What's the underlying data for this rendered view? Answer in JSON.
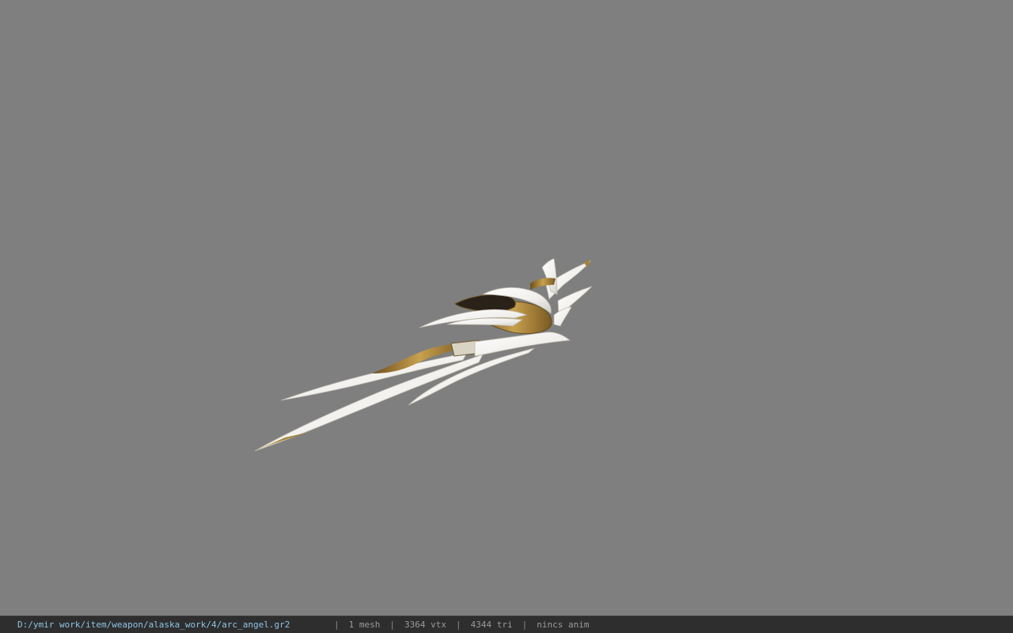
{
  "viewer": {
    "background_color": "#7f7f7f",
    "model_name": "arc_angel"
  },
  "status_bar": {
    "file_path": "D:/ymir work/item/weapon/alaska_work/4/arc_angel.gr2",
    "separator": "|",
    "mesh_count": "1 mesh",
    "vertex_count": "3364 vtx",
    "triangle_count": "4344 tri",
    "animation": "nincs anim",
    "path_color": "#8fc4e6",
    "text_color": "#9a9a9a",
    "bar_color": "#2e2e2e"
  }
}
